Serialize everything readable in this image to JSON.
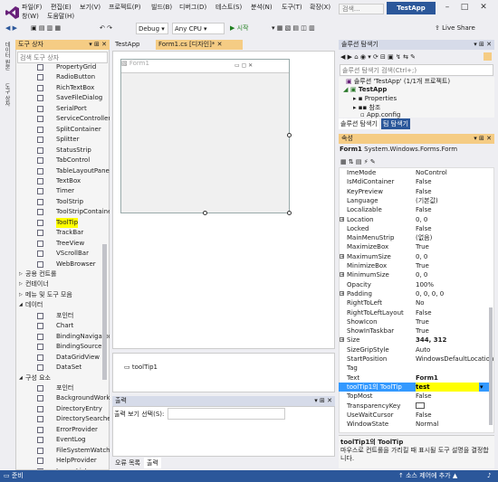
{
  "menu": {
    "file": "파일(F)",
    "edit": "편집(E)",
    "view": "보기(V)",
    "project": "프로젝트(P)",
    "build": "빌드(B)",
    "debug": "디버그(D)",
    "test": "테스트(S)",
    "analyze": "분석(N)",
    "tools": "도구(T)",
    "extensions": "확장(X)",
    "window": "창(W)",
    "help": "도움말(H)"
  },
  "search_placeholder": "검색...",
  "app_name": "TestApp",
  "toolbar": {
    "config": "Debug",
    "platform": "Any CPU",
    "start": "▶ 시작",
    "live_share": "Live Share"
  },
  "left_strip": {
    "server_explorer": "데이터 원본",
    "toolbox": "도구 상자"
  },
  "toolbox": {
    "title": "도구 상자",
    "search_placeholder": "검색 도구 상자",
    "items": [
      "PropertyGrid",
      "RadioButton",
      "RichTextBox",
      "SaveFileDialog",
      "SerialPort",
      "ServiceController",
      "SplitContainer",
      "Splitter",
      "StatusStrip",
      "TabControl",
      "TableLayoutPanel",
      "TextBox",
      "Timer",
      "ToolStrip",
      "ToolStripContainer",
      "ToolTip",
      "TrackBar",
      "TreeView",
      "VScrollBar",
      "WebBrowser"
    ],
    "groups": [
      "공용 컨트롤",
      "컨테이너",
      "메뉴 및 도구 모음"
    ],
    "data_group": "데이터",
    "data_items": [
      "포인터",
      "Chart",
      "BindingNavigator",
      "BindingSource",
      "DataGridView",
      "DataSet"
    ],
    "component_group": "구성 요소",
    "component_items": [
      "포인터",
      "BackgroundWorker",
      "DirectoryEntry",
      "DirectorySearcher",
      "ErrorProvider",
      "EventLog",
      "FileSystemWatcher",
      "HelpProvider",
      "ImageList"
    ]
  },
  "tabs": {
    "test_app": "TestApp",
    "form1_design": "Form1.cs [디자인]*"
  },
  "designer": {
    "form_title": "Form1",
    "tray_item": "toolTip1"
  },
  "output": {
    "title": "출력",
    "source_label": "출력 보기 선택(S):",
    "tab_errors": "오류 목록",
    "tab_output": "출력"
  },
  "solution_explorer": {
    "title": "솔루션 탐색기",
    "search_placeholder": "솔루션 탐색기 검색(Ctrl+;)",
    "solution": "솔루션 'TestApp' (1/1개 프로젝트)",
    "project": "TestApp",
    "properties": "Properties",
    "references": "참조",
    "app_config": "App.config",
    "tab_solution": "솔루션 탐색기",
    "tab_team": "팀 탐색기"
  },
  "properties": {
    "title": "속성",
    "object": "Form1",
    "object_type": "System.Windows.Forms.Form",
    "rows": [
      {
        "k": "ImeMode",
        "v": "NoControl",
        "ex": ""
      },
      {
        "k": "IsMdiContainer",
        "v": "False",
        "ex": ""
      },
      {
        "k": "KeyPreview",
        "v": "False",
        "ex": ""
      },
      {
        "k": "Language",
        "v": "(기본값)",
        "ex": ""
      },
      {
        "k": "Localizable",
        "v": "False",
        "ex": ""
      },
      {
        "k": "Location",
        "v": "0, 0",
        "ex": "+"
      },
      {
        "k": "Locked",
        "v": "False",
        "ex": ""
      },
      {
        "k": "MainMenuStrip",
        "v": "(없음)",
        "ex": ""
      },
      {
        "k": "MaximizeBox",
        "v": "True",
        "ex": ""
      },
      {
        "k": "MaximumSize",
        "v": "0, 0",
        "ex": "+"
      },
      {
        "k": "MinimizeBox",
        "v": "True",
        "ex": ""
      },
      {
        "k": "MinimumSize",
        "v": "0, 0",
        "ex": "+"
      },
      {
        "k": "Opacity",
        "v": "100%",
        "ex": ""
      },
      {
        "k": "Padding",
        "v": "0, 0, 0, 0",
        "ex": "+"
      },
      {
        "k": "RightToLeft",
        "v": "No",
        "ex": ""
      },
      {
        "k": "RightToLeftLayout",
        "v": "False",
        "ex": ""
      },
      {
        "k": "ShowIcon",
        "v": "True",
        "ex": ""
      },
      {
        "k": "ShowInTaskbar",
        "v": "True",
        "ex": ""
      },
      {
        "k": "Size",
        "v": "344, 312",
        "ex": "+"
      },
      {
        "k": "SizeGripStyle",
        "v": "Auto",
        "ex": ""
      },
      {
        "k": "StartPosition",
        "v": "WindowsDefaultLocation",
        "ex": ""
      },
      {
        "k": "Tag",
        "v": "",
        "ex": ""
      },
      {
        "k": "Text",
        "v": "Form1",
        "ex": ""
      },
      {
        "k": "toolTip1의 ToolTip",
        "v": "test",
        "ex": ""
      },
      {
        "k": "TopMost",
        "v": "False",
        "ex": ""
      },
      {
        "k": "TransparencyKey",
        "v": "",
        "ex": ""
      },
      {
        "k": "UseWaitCursor",
        "v": "False",
        "ex": ""
      },
      {
        "k": "WindowState",
        "v": "Normal",
        "ex": ""
      }
    ],
    "desc_title": "toolTip1의 ToolTip",
    "desc_text": "마우스로 컨트롤을 가리킬 때 표시될 도구 설명을 결정합니다."
  },
  "status": {
    "ready": "준비",
    "source_control": "↑ 소스 제어에 추가 ▲"
  },
  "colors": {
    "accent": "#2b579a",
    "highlight": "#ffff00",
    "active_header": "#f5cc84"
  }
}
